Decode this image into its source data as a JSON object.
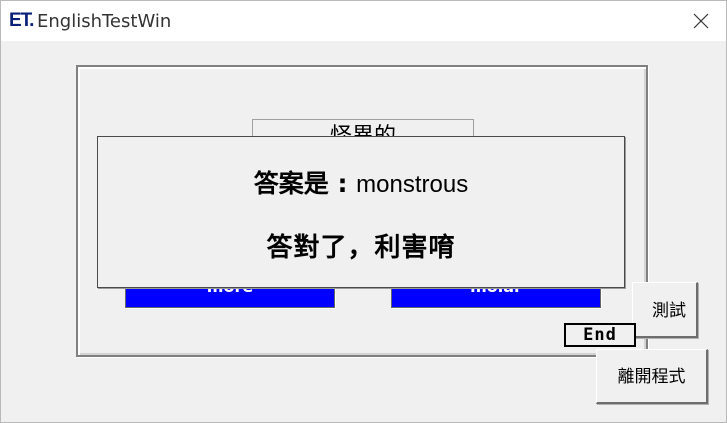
{
  "window": {
    "logo": "ET.",
    "title": "EnglishTestWin",
    "close_icon": "close-icon"
  },
  "quiz": {
    "word": "怪異的",
    "choices": [
      "more",
      "molar"
    ],
    "end_label": "End"
  },
  "buttons": {
    "test_label": "測試",
    "exit_label": "離開程式"
  },
  "dialog": {
    "answer_label": "答案是 : ",
    "answer_word": "monstrous",
    "result_text": "答對了，利害唷"
  },
  "colors": {
    "choice_bg": "#0000ff",
    "logo": "#0a1f7a"
  }
}
